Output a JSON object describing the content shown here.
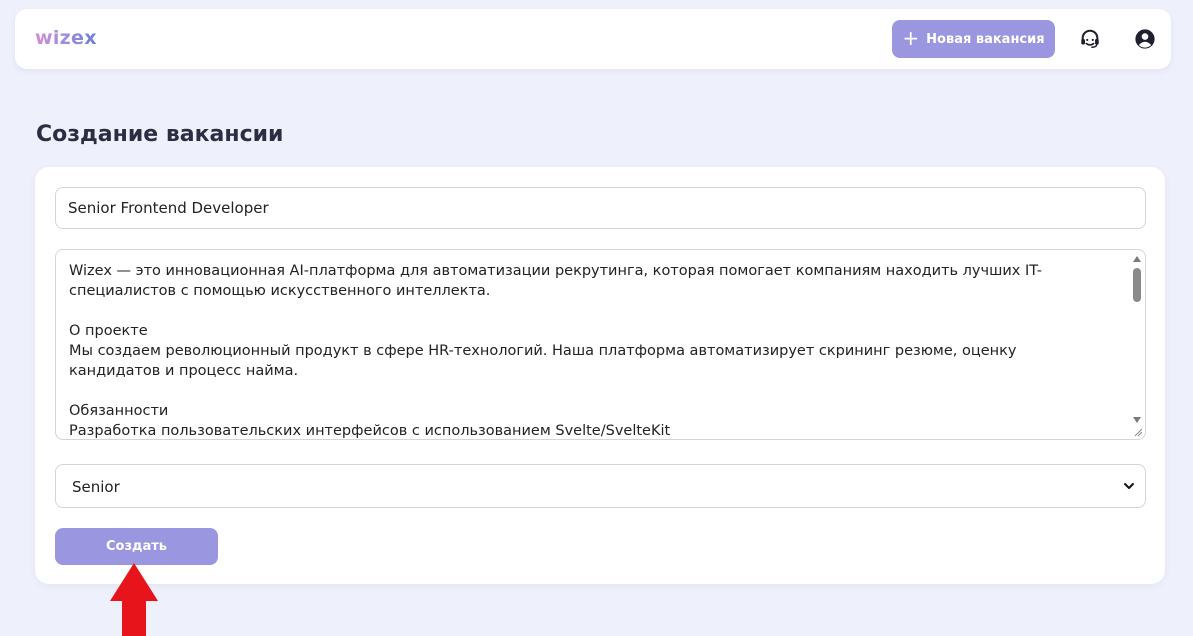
{
  "header": {
    "logo": "wizex",
    "new_vacancy_label": "Новая вакансия",
    "support_icon": "headset-icon",
    "profile_icon": "user-circle-icon"
  },
  "page": {
    "title": "Создание вакансии"
  },
  "form": {
    "title_value": "Senior Frontend Developer",
    "description_value": "Wizex — это инновационная AI-платформа для автоматизации рекрутинга, которая помогает компаниям находить лучших IT-\nспециалистов с помощью искусственного интеллекта.\n\nО проекте\nМы создаем революционный продукт в сфере HR-технологий. Наша платформа автоматизирует скрининг резюме, оценку\nкандидатов и процесс найма.\n\nОбязанности\nРазработка пользовательских интерфейсов с использованием Svelte/SvelteKit",
    "level_selected": "Senior",
    "submit_label": "Создать"
  },
  "colors": {
    "background": "#eef0fb",
    "accent": "#9b96e0",
    "annotation": "#e8141c"
  }
}
